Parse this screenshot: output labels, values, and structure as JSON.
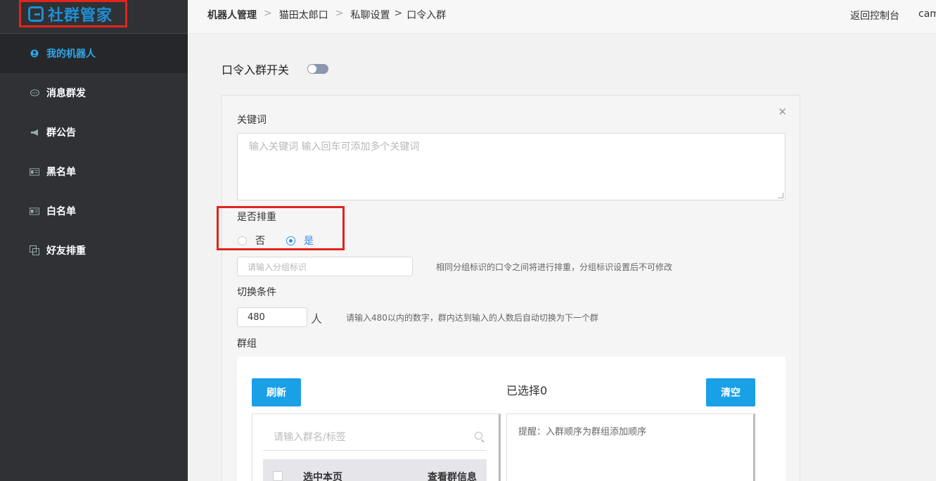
{
  "logo": {
    "text": "社群管家",
    "border_color": "#e0251b",
    "text_color": "#1e90d6"
  },
  "sidebar": {
    "items": [
      {
        "label": "我的机器人",
        "icon": "user-circle-icon",
        "active": true
      },
      {
        "label": "消息群发",
        "icon": "chat-bubble-icon",
        "active": false
      },
      {
        "label": "群公告",
        "icon": "megaphone-icon",
        "active": false
      },
      {
        "label": "黑名单",
        "icon": "id-card-icon",
        "active": false
      },
      {
        "label": "白名单",
        "icon": "id-card-icon",
        "active": false
      },
      {
        "label": "好友排重",
        "icon": "duplicate-icon",
        "active": false
      }
    ]
  },
  "header": {
    "breadcrumb": [
      "机器人管理",
      "猫田太郎口",
      "私聊设置",
      "口令入群"
    ],
    "back_link": "返回控制台",
    "user": "cam"
  },
  "form": {
    "switch_label": "口令入群开关",
    "switch_on": false,
    "keyword_label": "关键词",
    "keyword_placeholder": "输入关键词 输入回车可添加多个关键词",
    "dedup_label": "是否排重",
    "dedup_options": [
      "否",
      "是"
    ],
    "dedup_selected": "是",
    "group_id_placeholder": "请输入分组标识",
    "group_id_hint": "相同分组标识的口令之间将进行排重，分组标识设置后不可修改",
    "switch_condition_label": "切换条件",
    "switch_condition_value": "480",
    "switch_condition_unit": "人",
    "switch_condition_hint": "请输入480以内的数字，群内达到输入的人数后自动切换为下一个群",
    "group_label": "群组"
  },
  "groups": {
    "refresh_button": "刷新",
    "clear_button": "清空",
    "selected_title": "已选择0",
    "search_placeholder": "请输入群名/标签",
    "select_page_label": "选中本页",
    "view_info_label": "查看群信息",
    "selected_tip": "提醒：入群顺序为群组添加顺序",
    "accent_color": "#1aa0e6"
  }
}
